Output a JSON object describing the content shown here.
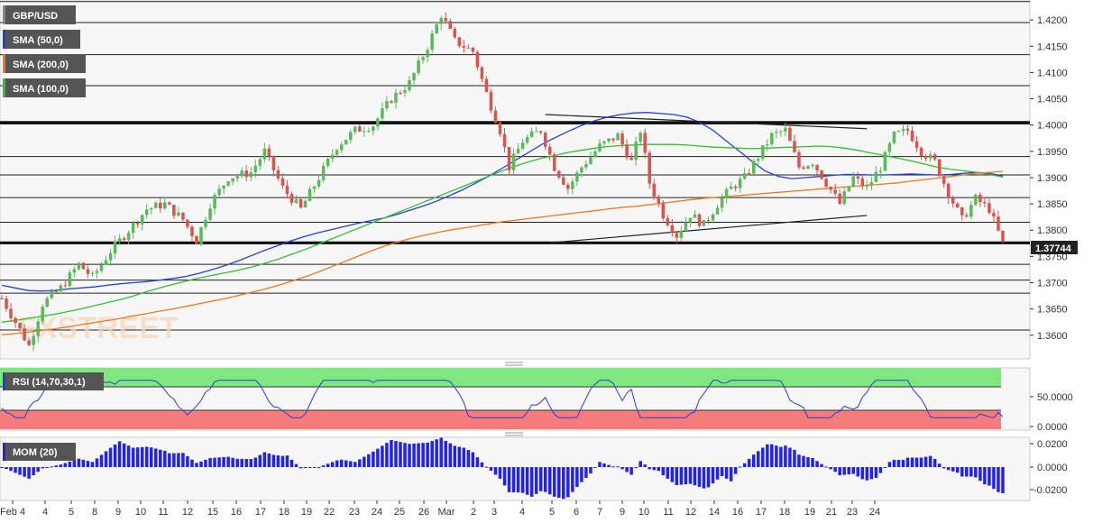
{
  "symbol": "GBP/USD",
  "watermark": "FXSTREET",
  "last_price_label": "1.37744",
  "legend": {
    "sma50": "SMA (50,0)",
    "sma200": "SMA (200,0)",
    "sma100": "SMA (100,0)",
    "rsi": "RSI (14,70,30,1)",
    "mom": "MOM (20)"
  },
  "colors": {
    "up": "#5cb85c",
    "down": "#d9534f",
    "sma50": "#2040e0",
    "sma100": "#30c030",
    "sma200": "#f07820",
    "rsi_line": "#2a3cd8",
    "rsi_overbought": "#7ee87e",
    "rsi_oversold": "#f47c7c",
    "mom_bar": "#2222ee",
    "label_bg": "#555555",
    "price_label_bg": "#222222"
  },
  "chart_data": [
    {
      "type": "candlestick",
      "title": "GBP/USD",
      "ylim": [
        1.3555,
        1.4238
      ],
      "y_ticks": [
        "1.4200",
        "1.4150",
        "1.4100",
        "1.4050",
        "1.4000",
        "1.3950",
        "1.3900",
        "1.3850",
        "1.3800",
        "1.3750",
        "1.3700",
        "1.3650",
        "1.3600"
      ],
      "x_ticks": [
        "Feb 4",
        "4",
        "5",
        "8",
        "9",
        "10",
        "11",
        "12",
        "15",
        "16",
        "17",
        "18",
        "19",
        "22",
        "23",
        "24",
        "25",
        "26",
        "Mar",
        "2",
        "3",
        "4",
        "5",
        "6",
        "7",
        "9",
        "10",
        "11",
        "12",
        "14",
        "16",
        "17",
        "18",
        "19",
        "21",
        "23",
        "24"
      ],
      "grid": "horizontal",
      "horizontal_levels": [
        1.4235,
        1.4195,
        1.4134,
        1.4075,
        1.4002,
        1.394,
        1.3905,
        1.3862,
        1.3815,
        1.3774,
        1.3735,
        1.3705,
        1.368,
        1.361
      ],
      "key_levels": [
        1.4005,
        1.3776
      ],
      "trendlines": [
        {
          "from": {
            "i": 120,
            "y": 1.402
          },
          "to": {
            "i": 191,
            "y": 1.3993
          }
        },
        {
          "from": {
            "i": 121,
            "y": 1.3776
          },
          "to": {
            "i": 191,
            "y": 1.3828
          }
        }
      ],
      "candles_ohlc": [],
      "candles_note": "Hourly-ish candles from Feb 4 to Mar 24",
      "series": [
        {
          "name": "SMA (50,0)",
          "values": [
            1.3695,
            1.369,
            1.3685,
            1.3684,
            1.3685,
            1.3688,
            1.369,
            1.3692,
            1.3695,
            1.3698,
            1.37,
            1.3702,
            1.3705,
            1.3708,
            1.3712,
            1.3718,
            1.3725,
            1.3733,
            1.3742,
            1.3752,
            1.3762,
            1.3771,
            1.378,
            1.3788,
            1.3795,
            1.3801,
            1.3807,
            1.3813,
            1.3818,
            1.3823,
            1.383,
            1.3838,
            1.3846,
            1.3855,
            1.3866,
            1.3877,
            1.389,
            1.3903,
            1.3918,
            1.3933,
            1.3948,
            1.3963,
            1.3976,
            1.3988,
            1.3999,
            1.4008,
            1.4015,
            1.402,
            1.4023,
            1.4024,
            1.4022,
            1.402,
            1.4015,
            1.4005,
            1.399,
            1.397,
            1.395,
            1.393,
            1.3912,
            1.3902,
            1.3898,
            1.39,
            1.3902,
            1.3904,
            1.3906,
            1.3906,
            1.3905,
            1.3905,
            1.3906,
            1.3907,
            1.3906,
            1.3905,
            1.3906,
            1.3908,
            1.391,
            1.3908,
            1.3903
          ]
        },
        {
          "name": "SMA (100,0)",
          "values": [
            1.3625,
            1.3628,
            1.3632,
            1.3636,
            1.364,
            1.3645,
            1.365,
            1.3656,
            1.3662,
            1.3668,
            1.3675,
            1.3683,
            1.369,
            1.3697,
            1.3703,
            1.3709,
            1.3714,
            1.3719,
            1.3724,
            1.373,
            1.3737,
            1.3745,
            1.3754,
            1.3763,
            1.3773,
            1.3783,
            1.3793,
            1.3803,
            1.3813,
            1.3823,
            1.3833,
            1.3843,
            1.3853,
            1.3863,
            1.3873,
            1.3883,
            1.3893,
            1.3903,
            1.3913,
            1.3922,
            1.393,
            1.3937,
            1.3942,
            1.3948,
            1.3952,
            1.3956,
            1.3959,
            1.3961,
            1.3962,
            1.3963,
            1.3963,
            1.3963,
            1.3962,
            1.396,
            1.3958,
            1.3957,
            1.3956,
            1.3955,
            1.3956,
            1.3957,
            1.3958,
            1.3959,
            1.396,
            1.3959,
            1.3956,
            1.3952,
            1.3947,
            1.3942,
            1.3937,
            1.3932,
            1.3926,
            1.392,
            1.3916,
            1.3913,
            1.391,
            1.3906,
            1.3901
          ]
        },
        {
          "name": "SMA (200,0)",
          "values": [
            1.3601,
            1.3603,
            1.3606,
            1.3609,
            1.3612,
            1.3616,
            1.362,
            1.3624,
            1.3628,
            1.3632,
            1.3637,
            1.3641,
            1.3646,
            1.365,
            1.3655,
            1.366,
            1.3665,
            1.367,
            1.3676,
            1.3682,
            1.3688,
            1.3695,
            1.3703,
            1.3711,
            1.372,
            1.373,
            1.374,
            1.375,
            1.376,
            1.3769,
            1.3777,
            1.3784,
            1.379,
            1.3795,
            1.38,
            1.3804,
            1.3808,
            1.3812,
            1.3816,
            1.3819,
            1.3822,
            1.3825,
            1.3828,
            1.3831,
            1.3834,
            1.3837,
            1.384,
            1.3843,
            1.3845,
            1.3848,
            1.3851,
            1.3854,
            1.3857,
            1.386,
            1.3862,
            1.3864,
            1.3866,
            1.3868,
            1.387,
            1.3872,
            1.3874,
            1.3876,
            1.3878,
            1.388,
            1.3882,
            1.3884,
            1.3886,
            1.3888,
            1.389,
            1.3893,
            1.3896,
            1.3899,
            1.3902,
            1.3905,
            1.3908,
            1.391,
            1.3912
          ]
        }
      ]
    },
    {
      "type": "line",
      "title": "RSI (14,70,30,1)",
      "ylim": [
        0,
        100
      ],
      "y_ticks": [
        "50.0000",
        "0.0000"
      ],
      "overbought": 70,
      "oversold": 30
    },
    {
      "type": "bar",
      "title": "MOM (20)",
      "ylim": [
        -0.027,
        0.0225
      ],
      "y_ticks": [
        "0.0200",
        "0.0000",
        "-0.0200"
      ]
    }
  ]
}
